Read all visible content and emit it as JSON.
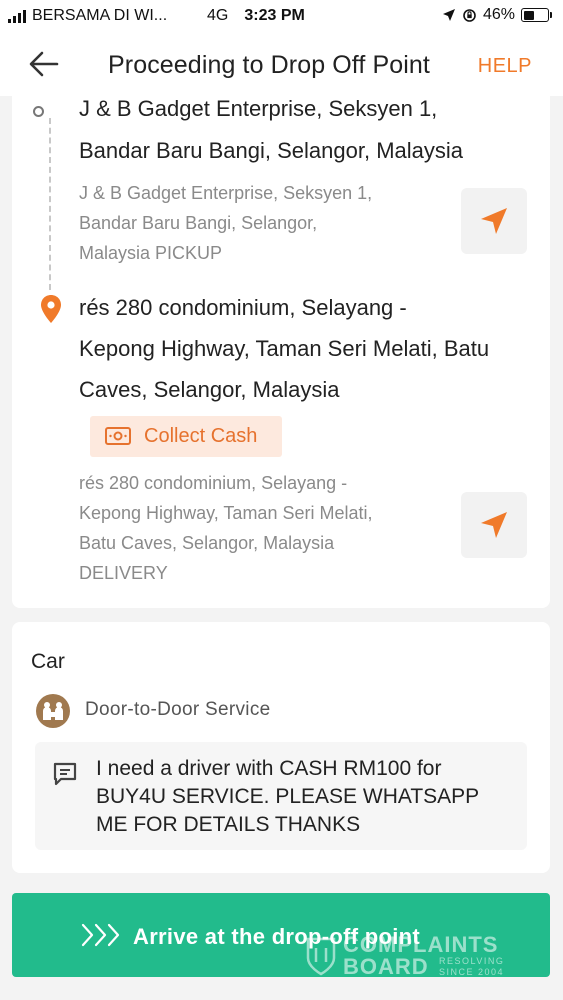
{
  "status_bar": {
    "carrier": "BERSAMA DI WI...",
    "network": "4G",
    "time": "3:23 PM",
    "battery_text": "46%",
    "battery_level": 0.46
  },
  "header": {
    "title": "Proceeding to Drop Off Point",
    "help_label": "HELP",
    "back_icon": "arrow-left-icon"
  },
  "route": {
    "pickup": {
      "title_line1": "J & B Gadget Enterprise, Seksyen 1,",
      "title_line2": "Bandar Baru Bangi, Selangor, Malaysia",
      "detail_line1": "J & B Gadget Enterprise, Seksyen 1,",
      "detail_line2": "Bandar Baru Bangi, Selangor,",
      "detail_line3": "Malaysia  PICKUP",
      "icon": "navigation-arrow-icon"
    },
    "dropoff": {
      "title_line1": "rés 280 condominium, Selayang -",
      "title_line2": "Kepong Highway, Taman Seri Melati, Batu",
      "title_line3": "Caves, Selangor, Malaysia",
      "badge_label": "Collect Cash",
      "detail_line1": "rés 280 condominium, Selayang -",
      "detail_line2": "Kepong Highway, Taman Seri Melati,",
      "detail_line3": "Batu Caves, Selangor, Malaysia",
      "detail_line4": "DELIVERY",
      "icon": "navigation-arrow-icon"
    }
  },
  "order": {
    "vehicle": "Car",
    "service": "Door-to-Door Service",
    "note_line1": "I need a driver with CASH RM100 for",
    "note_line2": "BUY4U SERVICE. PLEASE WHATSAPP",
    "note_line3": "ME FOR DETAILS THANKS"
  },
  "action": {
    "label": "Arrive at the drop-off point"
  },
  "watermark": {
    "line1": "COMPLAINTS",
    "line2": "BOARD",
    "line3": "RESOLVING",
    "line4": "SINCE 2004"
  },
  "colors": {
    "accent_orange": "#f07a2a",
    "action_green": "#22bb8c",
    "badge_bg": "#fde9de"
  }
}
